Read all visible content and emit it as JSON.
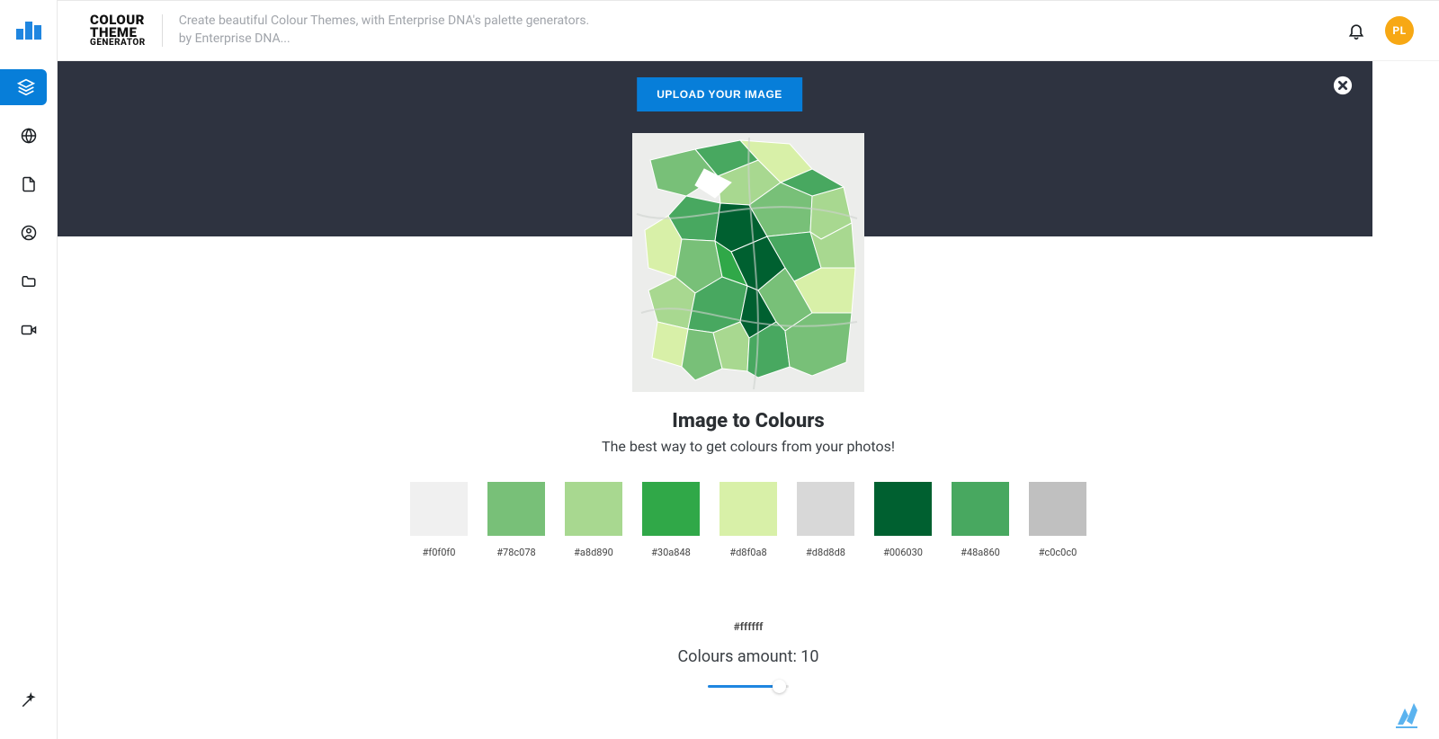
{
  "header": {
    "brand_line1": "COLOUR",
    "brand_line2": "THEME",
    "brand_line3": "GENERATOR",
    "desc_line1": "Create beautiful Colour Themes, with Enterprise DNA's palette generators.",
    "desc_line2": "by Enterprise DNA...",
    "avatar_initials": "PL"
  },
  "sidebar": {
    "items": [
      {
        "name": "layers-icon",
        "active": true
      },
      {
        "name": "globe-icon",
        "active": false
      },
      {
        "name": "file-icon",
        "active": false
      },
      {
        "name": "user-circle-icon",
        "active": false
      },
      {
        "name": "folder-icon",
        "active": false
      },
      {
        "name": "video-icon",
        "active": false
      }
    ],
    "bottom_icon": "wand-icon"
  },
  "actions": {
    "upload_label": "UPLOAD YOUR IMAGE",
    "close_label": "Close"
  },
  "content": {
    "title": "Image to Colours",
    "subtitle": "The best way to get colours from your photos!",
    "colours": [
      {
        "hex": "#f0f0f0"
      },
      {
        "hex": "#78c078"
      },
      {
        "hex": "#a8d890"
      },
      {
        "hex": "#30a848"
      },
      {
        "hex": "#d8f0a8"
      },
      {
        "hex": "#d8d8d8"
      },
      {
        "hex": "#006030"
      },
      {
        "hex": "#48a860"
      },
      {
        "hex": "#c0c0c0"
      }
    ],
    "extra_hex": "#ffffff",
    "amount_label": "Colours amount: ",
    "amount_value": "10"
  }
}
